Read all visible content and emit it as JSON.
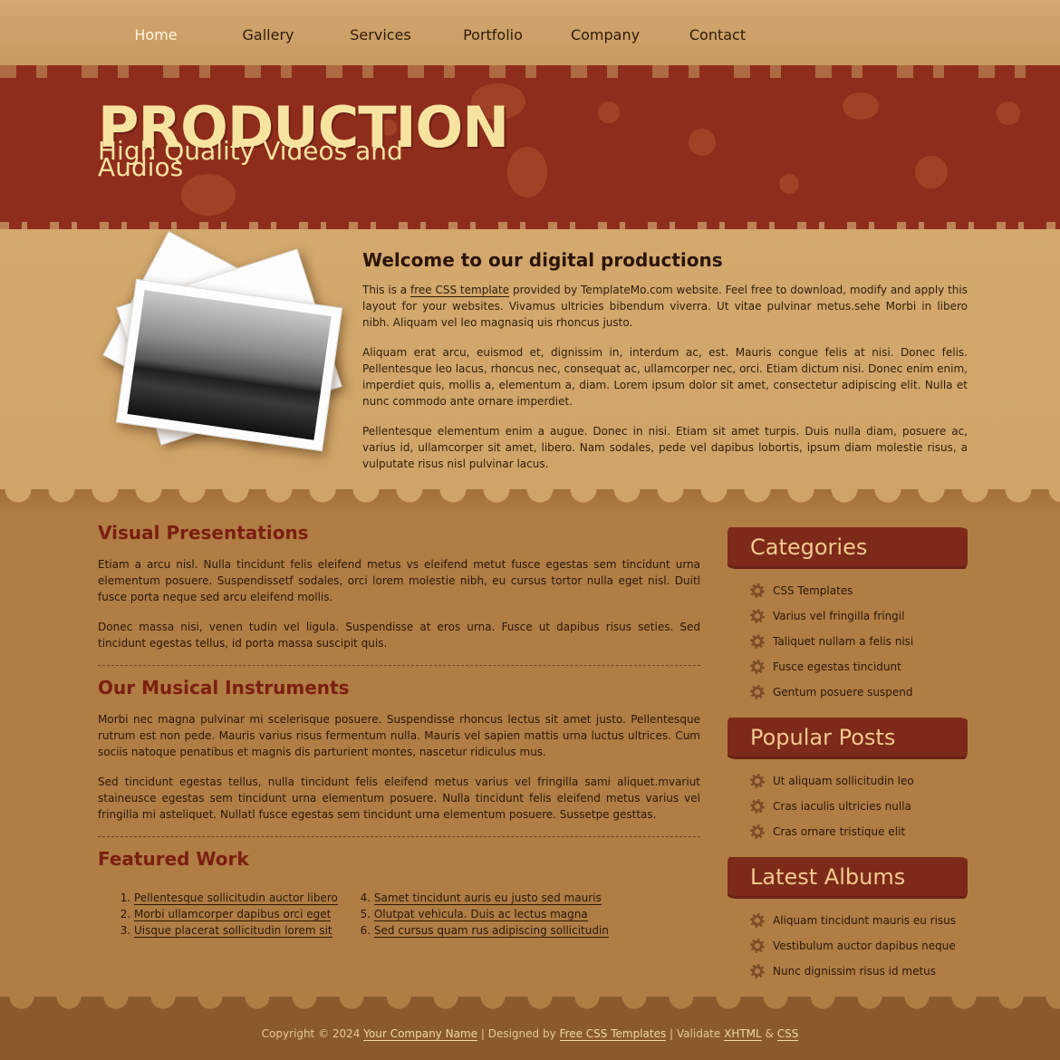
{
  "nav": {
    "items": [
      {
        "label": "Home",
        "active": true
      },
      {
        "label": "Gallery"
      },
      {
        "label": "Services"
      },
      {
        "label": "Portfolio"
      },
      {
        "label": "Company"
      },
      {
        "label": "Contact"
      }
    ]
  },
  "header": {
    "title": "PRODUCTION",
    "tagline": "High Quality Videos and Audios"
  },
  "welcome": {
    "title": "Welcome to our digital productions",
    "p1_before": "This is a",
    "p1_link": "free CSS template",
    "p1_after": "provided by TemplateMo.com website. Feel free to download, modify and apply this layout for your websites. Vivamus ultricies bibendum viverra. Ut vitae pulvinar metus.sehe Morbi in libero nibh. Aliquam vel leo magnasiq uis rhoncus justo.",
    "p2": "Aliquam erat arcu, euismod et, dignissim in, interdum ac, est. Mauris congue felis at nisi. Donec felis. Pellentesque leo lacus, rhoncus nec, consequat ac, ullamcorper nec, orci. Etiam dictum nisi. Donec enim enim, imperdiet quis, mollis a, elementum a, diam. Lorem ipsum dolor sit amet, consectetur adipiscing elit. Nulla et nunc commodo ante ornare imperdiet.",
    "p3": "Pellentesque elementum enim a augue. Donec in nisi. Etiam sit amet turpis. Duis nulla diam, posuere ac, varius id, ullamcorper sit amet, libero. Nam sodales, pede vel dapibus lobortis, ipsum diam molestie risus, a vulputate risus nisl pulvinar lacus."
  },
  "sections": {
    "visual": {
      "title": "Visual Presentations",
      "p1": "Etiam a arcu nisl. Nulla tincidunt felis eleifend metus vs eleifend metut fusce egestas sem tincidunt urna elementum posuere. Suspendissetf sodales, orci lorem molestie nibh, eu cursus tortor nulla eget nisl. Duitl fusce porta neque sed arcu eleifend mollis.",
      "p2": "Donec massa nisi, venen tudin vel ligula. Suspendisse at eros urna. Fusce ut dapibus risus seties. Sed tincidunt egestas tellus, id porta massa suscipit quis."
    },
    "musical": {
      "title": "Our Musical Instruments",
      "p1": "Morbi nec magna pulvinar mi scelerisque posuere. Suspendisse rhoncus lectus sit amet justo. Pellentesque rutrum est non pede. Mauris varius risus fermentum nulla. Mauris vel sapien mattis urna luctus ultrices. Cum sociis natoque penatibus et magnis dis parturient montes, nascetur ridiculus mus.",
      "p2": "Sed tincidunt egestas tellus, nulla tincidunt felis eleifend metus varius vel fringilla sami aliquet.mvariut staineusce egestas sem tincidunt urna elementum posuere. Nulla tincidunt felis eleifend metus varius vel fringilla mi asteliquet. Nullatl fusce egestas sem tincidunt urna elementum posuere. Sussetpe gesttas."
    },
    "featured": {
      "title": "Featured Work",
      "list1": [
        "Pellentesque sollicitudin auctor libero",
        "Morbi ullamcorper dapibus orci eget",
        "Uisque placerat sollicitudin lorem sit"
      ],
      "list2": [
        "Samet tincidunt auris eu justo sed mauris",
        "Olutpat vehicula. Duis ac lectus magna",
        "Sed cursus quam rus adipiscing sollicitudin"
      ]
    }
  },
  "sidebar": {
    "categories": {
      "title": "Categories",
      "items": [
        "CSS Templates",
        "Varius vel fringilla fringil",
        "Taliquet nullam a felis nisi",
        "Fusce egestas tincidunt",
        "Gentum posuere suspend"
      ]
    },
    "popular": {
      "title": "Popular Posts",
      "items": [
        "Ut aliquam sollicitudin leo",
        "Cras iaculis ultricies nulla",
        "Cras ornare tristique elit"
      ]
    },
    "albums": {
      "title": "Latest Albums",
      "items": [
        "Aliquam tincidunt mauris eu risus",
        "Vestibulum auctor dapibus neque",
        "Nunc dignissim risus id metus"
      ]
    }
  },
  "footer": {
    "copyright": "Copyright © 2024",
    "company": "Your Company Name",
    "sep1": "| Designed by",
    "designer": "Free CSS Templates",
    "sep2": "| Validate",
    "xhtml": "XHTML",
    "amp": "&",
    "css": "CSS"
  }
}
